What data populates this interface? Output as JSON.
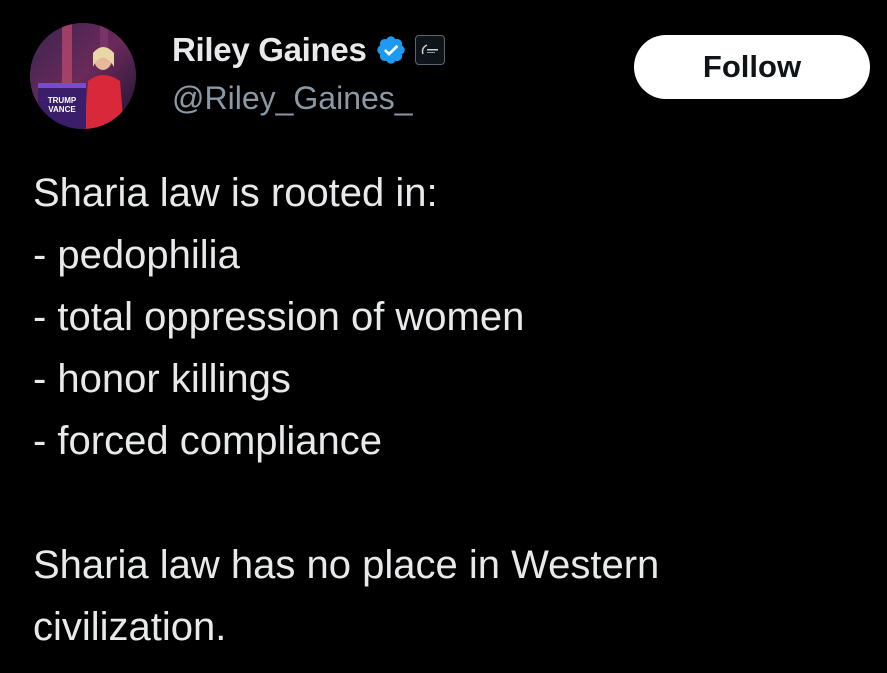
{
  "author": {
    "display_name": "Riley Gaines",
    "handle": "@Riley_Gaines_",
    "avatar_sign_text": "TRUMP VANCE",
    "verified": true,
    "verified_color": "#1d9bf0"
  },
  "actions": {
    "follow_label": "Follow"
  },
  "tweet": {
    "intro": "Sharia law is rooted in:",
    "list": [
      "- pedophilia",
      "- total oppression of women",
      "- honor killings",
      "- forced compliance"
    ],
    "conclusion": [
      "Sharia law has no place in Western",
      "civilization."
    ]
  },
  "colors": {
    "background": "#000000",
    "text": "#e7e9ea",
    "secondary_text": "#8b98a5",
    "follow_button_bg": "#ffffff"
  },
  "icons": {
    "verified": "verified-check-icon",
    "affiliate": "affiliate-badge-icon"
  }
}
